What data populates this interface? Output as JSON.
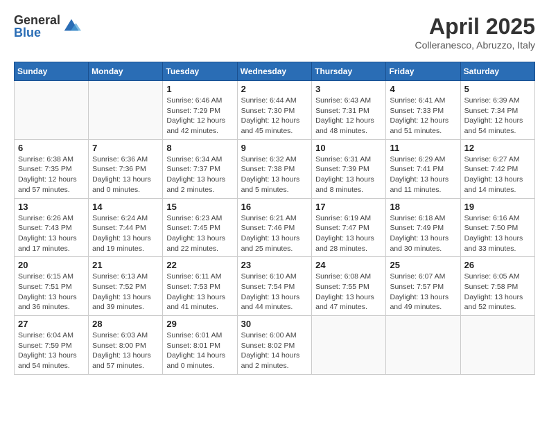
{
  "header": {
    "logo_general": "General",
    "logo_blue": "Blue",
    "month_title": "April 2025",
    "location": "Colleranesco, Abruzzo, Italy"
  },
  "weekdays": [
    "Sunday",
    "Monday",
    "Tuesday",
    "Wednesday",
    "Thursday",
    "Friday",
    "Saturday"
  ],
  "days": {
    "1": {
      "sunrise": "6:46 AM",
      "sunset": "7:29 PM",
      "daylight": "12 hours and 42 minutes."
    },
    "2": {
      "sunrise": "6:44 AM",
      "sunset": "7:30 PM",
      "daylight": "12 hours and 45 minutes."
    },
    "3": {
      "sunrise": "6:43 AM",
      "sunset": "7:31 PM",
      "daylight": "12 hours and 48 minutes."
    },
    "4": {
      "sunrise": "6:41 AM",
      "sunset": "7:33 PM",
      "daylight": "12 hours and 51 minutes."
    },
    "5": {
      "sunrise": "6:39 AM",
      "sunset": "7:34 PM",
      "daylight": "12 hours and 54 minutes."
    },
    "6": {
      "sunrise": "6:38 AM",
      "sunset": "7:35 PM",
      "daylight": "12 hours and 57 minutes."
    },
    "7": {
      "sunrise": "6:36 AM",
      "sunset": "7:36 PM",
      "daylight": "13 hours and 0 minutes."
    },
    "8": {
      "sunrise": "6:34 AM",
      "sunset": "7:37 PM",
      "daylight": "13 hours and 2 minutes."
    },
    "9": {
      "sunrise": "6:32 AM",
      "sunset": "7:38 PM",
      "daylight": "13 hours and 5 minutes."
    },
    "10": {
      "sunrise": "6:31 AM",
      "sunset": "7:39 PM",
      "daylight": "13 hours and 8 minutes."
    },
    "11": {
      "sunrise": "6:29 AM",
      "sunset": "7:41 PM",
      "daylight": "13 hours and 11 minutes."
    },
    "12": {
      "sunrise": "6:27 AM",
      "sunset": "7:42 PM",
      "daylight": "13 hours and 14 minutes."
    },
    "13": {
      "sunrise": "6:26 AM",
      "sunset": "7:43 PM",
      "daylight": "13 hours and 17 minutes."
    },
    "14": {
      "sunrise": "6:24 AM",
      "sunset": "7:44 PM",
      "daylight": "13 hours and 19 minutes."
    },
    "15": {
      "sunrise": "6:23 AM",
      "sunset": "7:45 PM",
      "daylight": "13 hours and 22 minutes."
    },
    "16": {
      "sunrise": "6:21 AM",
      "sunset": "7:46 PM",
      "daylight": "13 hours and 25 minutes."
    },
    "17": {
      "sunrise": "6:19 AM",
      "sunset": "7:47 PM",
      "daylight": "13 hours and 28 minutes."
    },
    "18": {
      "sunrise": "6:18 AM",
      "sunset": "7:49 PM",
      "daylight": "13 hours and 30 minutes."
    },
    "19": {
      "sunrise": "6:16 AM",
      "sunset": "7:50 PM",
      "daylight": "13 hours and 33 minutes."
    },
    "20": {
      "sunrise": "6:15 AM",
      "sunset": "7:51 PM",
      "daylight": "13 hours and 36 minutes."
    },
    "21": {
      "sunrise": "6:13 AM",
      "sunset": "7:52 PM",
      "daylight": "13 hours and 39 minutes."
    },
    "22": {
      "sunrise": "6:11 AM",
      "sunset": "7:53 PM",
      "daylight": "13 hours and 41 minutes."
    },
    "23": {
      "sunrise": "6:10 AM",
      "sunset": "7:54 PM",
      "daylight": "13 hours and 44 minutes."
    },
    "24": {
      "sunrise": "6:08 AM",
      "sunset": "7:55 PM",
      "daylight": "13 hours and 47 minutes."
    },
    "25": {
      "sunrise": "6:07 AM",
      "sunset": "7:57 PM",
      "daylight": "13 hours and 49 minutes."
    },
    "26": {
      "sunrise": "6:05 AM",
      "sunset": "7:58 PM",
      "daylight": "13 hours and 52 minutes."
    },
    "27": {
      "sunrise": "6:04 AM",
      "sunset": "7:59 PM",
      "daylight": "13 hours and 54 minutes."
    },
    "28": {
      "sunrise": "6:03 AM",
      "sunset": "8:00 PM",
      "daylight": "13 hours and 57 minutes."
    },
    "29": {
      "sunrise": "6:01 AM",
      "sunset": "8:01 PM",
      "daylight": "14 hours and 0 minutes."
    },
    "30": {
      "sunrise": "6:00 AM",
      "sunset": "8:02 PM",
      "daylight": "14 hours and 2 minutes."
    }
  }
}
